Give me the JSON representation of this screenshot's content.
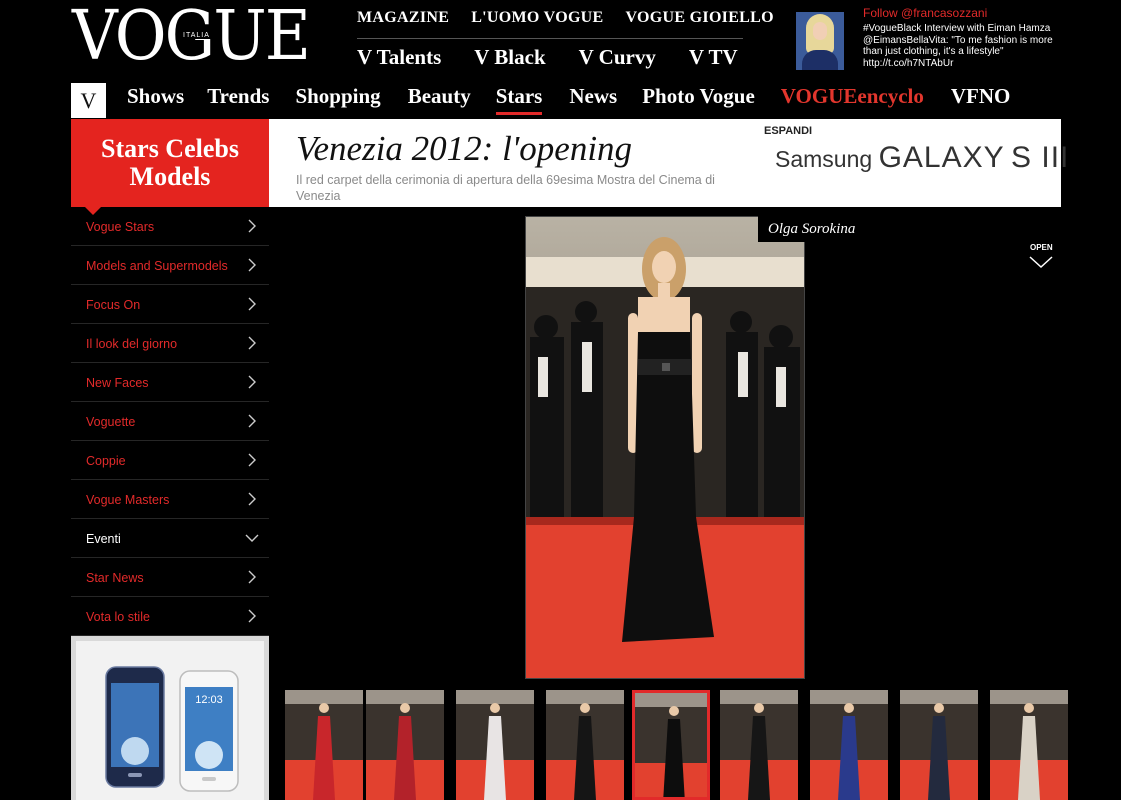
{
  "header": {
    "logo": "VOGUE",
    "logo_sub": "ITALIA",
    "top_links": [
      "MAGAZINE",
      "L'UOMO VOGUE",
      "VOGUE GIOIELLO"
    ],
    "channels": [
      "V Talents",
      "V Black",
      "V Curvy",
      "V TV"
    ]
  },
  "twitter": {
    "follow": "Follow @francasozzani",
    "tweet": "#VogueBlack Interview with Eiman Hamza @EimansBellaVita: \"To me fashion is more than just clothing, it's a lifestyle\" http://t.co/h7NTAbUr"
  },
  "mainnav": {
    "v_label": "V",
    "items": [
      "Shows",
      "Trends",
      "Shopping",
      "Beauty",
      "Stars",
      "News",
      "Photo Vogue",
      "VOGUEencyclo",
      "VFNO"
    ],
    "active": "Stars"
  },
  "section": {
    "line1": "Stars Celebs",
    "line2": "Models"
  },
  "page": {
    "title": "Venezia 2012: l'opening",
    "subtitle": "Il red carpet della cerimonia di apertura della 69esima Mostra del Cinema di Venezia"
  },
  "ad": {
    "label": "ESPANDI",
    "brand": "Samsung",
    "product": "GALAXY",
    "model": "S III"
  },
  "sidebar": {
    "items": [
      {
        "label": "Vogue Stars",
        "icon": "chevron-right-icon"
      },
      {
        "label": "Models and Supermodels",
        "icon": "chevron-right-icon"
      },
      {
        "label": "Focus On",
        "icon": "chevron-right-icon"
      },
      {
        "label": "Il look del giorno",
        "icon": "chevron-right-icon"
      },
      {
        "label": "New Faces",
        "icon": "chevron-right-icon"
      },
      {
        "label": "Voguette",
        "icon": "chevron-right-icon"
      },
      {
        "label": "Coppie",
        "icon": "chevron-right-icon"
      },
      {
        "label": "Vogue Masters",
        "icon": "chevron-right-icon"
      },
      {
        "label": "Eventi",
        "icon": "chevron-down-icon"
      },
      {
        "label": "Star News",
        "icon": "chevron-right-icon"
      },
      {
        "label": "Vota lo stile",
        "icon": "chevron-right-icon"
      }
    ]
  },
  "phone_ad": {
    "clock": "12:03"
  },
  "gallery": {
    "caption": "Olga Sorokina",
    "open_label": "OPEN",
    "active_thumb": 4,
    "thumbs": [
      {
        "dress": "#c8262b"
      },
      {
        "dress": "#b3222a"
      },
      {
        "dress": "#e8e4e4"
      },
      {
        "dress": "#151515"
      },
      {
        "dress": "#0d0d0d"
      },
      {
        "dress": "#161616"
      },
      {
        "dress": "#2a3a8c"
      },
      {
        "dress": "#232a3e"
      },
      {
        "dress": "#d9d2c6"
      }
    ]
  },
  "colors": {
    "accent": "#e4241f",
    "background": "#000000",
    "carpet": "#e2412f"
  }
}
